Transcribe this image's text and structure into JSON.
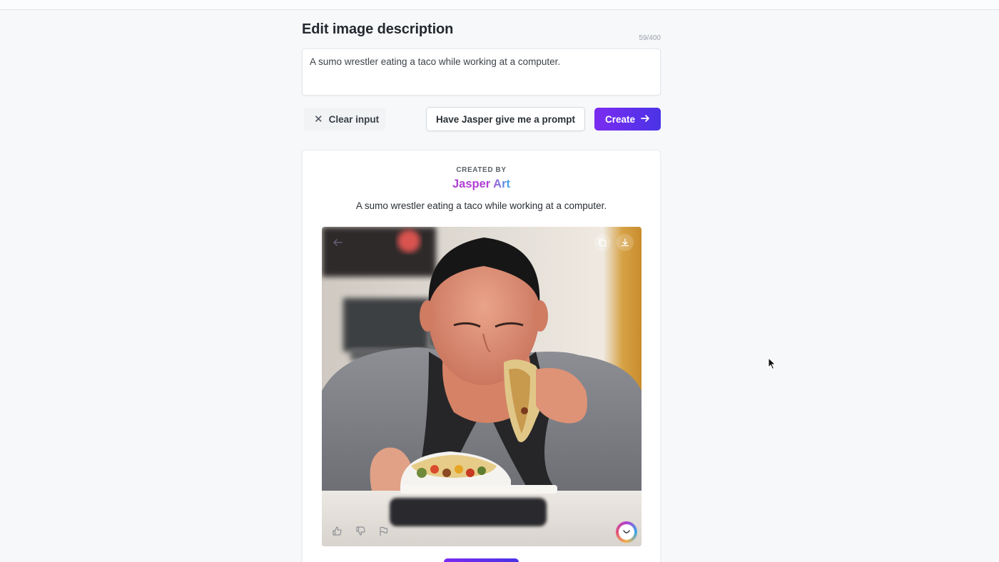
{
  "editor": {
    "title": "Edit image description",
    "char_counter": "59/400",
    "description_value": "A sumo wrestler eating a taco while working at a computer."
  },
  "actions": {
    "clear_label": "Clear input",
    "prompt_label": "Have Jasper give me a prompt",
    "create_label": "Create"
  },
  "result": {
    "created_by_label": "CREATED BY",
    "brand_part1": "Jasper ",
    "brand_part2": "Art",
    "caption": "A sumo wrestler eating a taco while working at a computer."
  },
  "icons": {
    "clear": "close-icon",
    "create": "arrow-right-icon",
    "back": "arrow-left-icon",
    "copy": "copy-icon",
    "download": "download-icon",
    "like": "thumbs-up-icon",
    "dislike": "thumbs-down-icon",
    "report": "flag-icon",
    "jasper": "jasper-logo-icon"
  },
  "colors": {
    "accent_start": "#7b2cf0",
    "accent_end": "#4a33e6",
    "brand_jasper": "#b13fd2",
    "brand_art_end": "#3ca9e8"
  }
}
